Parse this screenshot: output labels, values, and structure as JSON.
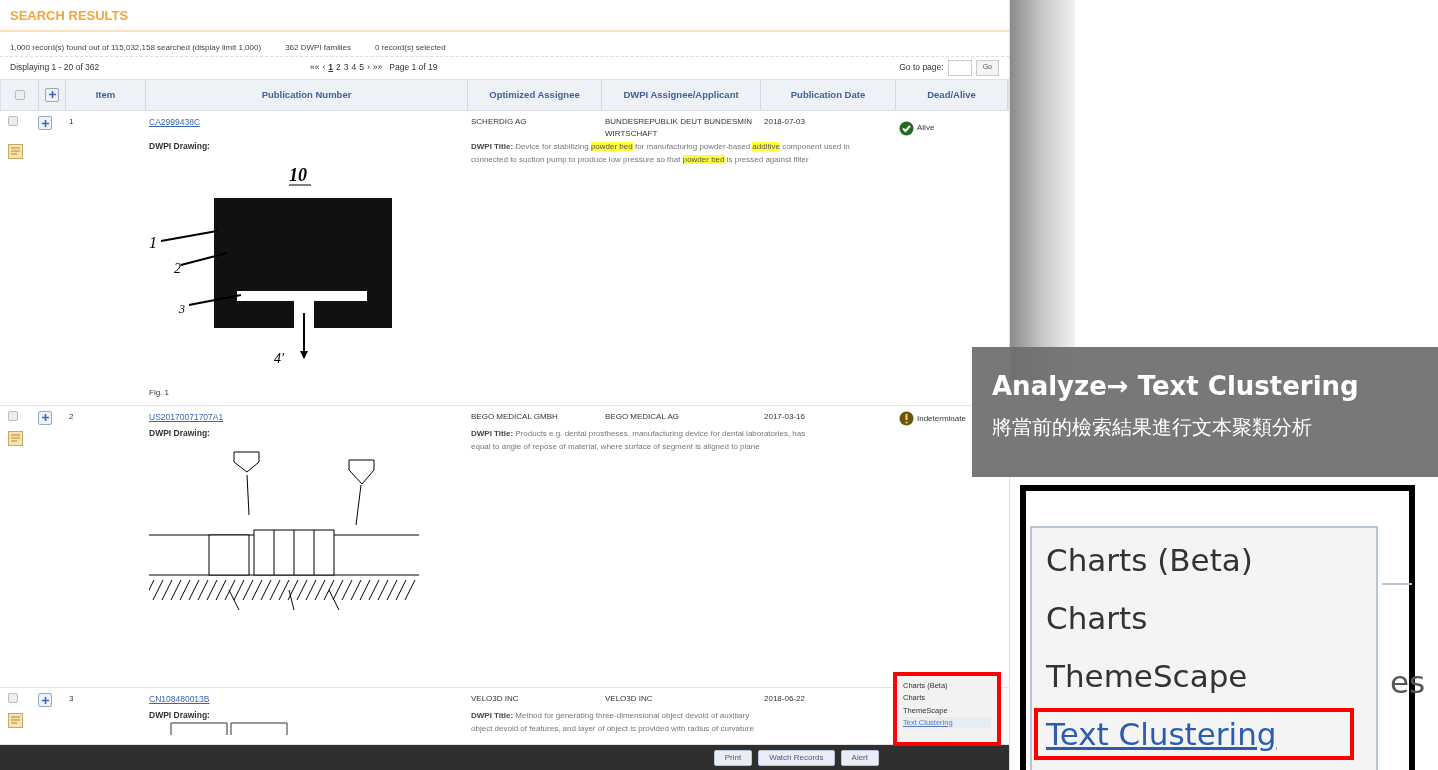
{
  "header": {
    "title": "SEARCH RESULTS"
  },
  "summary": [
    "1,000 record(s) found out of 115,032,158 searched (display limit 1,000)",
    "362 DWPI families",
    "0 record(s) selected"
  ],
  "pager": {
    "displaying": "Displaying 1 - 20 of 362",
    "first": "««",
    "prev": "‹",
    "pages": [
      {
        "label": "1",
        "selected": true
      },
      {
        "label": "2",
        "selected": false
      },
      {
        "label": "3",
        "selected": false
      },
      {
        "label": "4",
        "selected": false
      },
      {
        "label": "5",
        "selected": false
      }
    ],
    "next": "›",
    "last": "»»",
    "page_info": "Page 1 of 19",
    "goto_label": "Go to page:",
    "go_button": "Go"
  },
  "table": {
    "columns": [
      "Item",
      "Publication Number",
      "Optimized Assignee",
      "DWPI Assignee/Applicant",
      "Publication Date",
      "Dead/Alive"
    ],
    "header_checked": false,
    "rows": [
      {
        "item": "1",
        "checked": false,
        "publication_number": "CA2999438C",
        "optimized_assignee": "SCHERDIG AG",
        "dwpi_assignee": "BUNDESREPUBLIK DEUT BUNDESMIN WIRTSCHAFT",
        "date": "2018-07-03",
        "status": {
          "kind": "alive",
          "label": "Alive"
        },
        "drawing_label": "DWPI Drawing:",
        "kind": "block",
        "drawing_labels": [
          "10",
          "1",
          "2",
          "3",
          "4'"
        ],
        "caption": "Fig. 1",
        "title_label": "DWPI Title:",
        "title_lines": [
          "Device for stabilizing **powder bed** for manufacturing powder-based **additive** component used in",
          "connected to suction pump to produce low pressure so that **powder bed** is pressed against filter"
        ]
      },
      {
        "item": "2",
        "checked": false,
        "publication_number": "US20170071707A1",
        "optimized_assignee": "BEGO MEDICAL GMBH",
        "dwpi_assignee": "BEGO MEDICAL AG",
        "date": "2017-03-16",
        "status": {
          "kind": "indeterminate",
          "label": "Indeterminate"
        },
        "drawing_label": "DWPI Drawing:",
        "kind": "section",
        "title_label": "DWPI Title:",
        "title_lines": [
          "Products e.g. dental prostheses, manufacturing device for dental laboratories, has",
          "equal to angle of repose of material, where surface of segment is aligned to plane"
        ]
      },
      {
        "item": "3",
        "checked": false,
        "publication_number": "CN108480013B",
        "optimized_assignee": "VELO3D INC",
        "dwpi_assignee": "VELO3D INC",
        "date": "2018-06-22",
        "drawing_label": "DWPI Drawing:",
        "kind": "boxes",
        "title_label": "DWPI Title:",
        "title_lines": [
          "Method for generating three-dimensional object devoid of auxiliary",
          "object devoid of features, and layer of object is provided with radius of curvature"
        ]
      }
    ]
  },
  "footer_buttons": [
    "Print",
    "Watch Records",
    "Alert"
  ],
  "analyze_menu": {
    "items": [
      {
        "label": "Charts (Beta)",
        "selected": false
      },
      {
        "label": "Charts",
        "selected": false
      },
      {
        "label": "ThemeScape",
        "selected": false
      },
      {
        "label": "Text Clustering",
        "selected": true
      }
    ]
  },
  "callout": {
    "title": "Analyze→ Text Clustering",
    "subtitle": "將當前的檢索結果進行文本聚類分析"
  },
  "zoom_inset": {
    "items": [
      {
        "label": "Charts (Beta)",
        "selected": false
      },
      {
        "label": "Charts",
        "selected": false
      },
      {
        "label": "ThemeScape",
        "selected": false
      },
      {
        "label": "Text Clustering",
        "selected": true
      }
    ],
    "partial_text": "es"
  }
}
